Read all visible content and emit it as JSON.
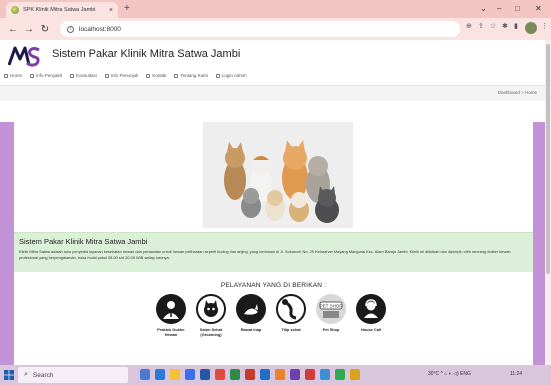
{
  "browser": {
    "tab_title": "SPK Klinik Mitra Satwa Jambi",
    "tab_close": "×",
    "new_tab": "+",
    "url": "localhost:8000",
    "minimize": "⌄",
    "min": "–",
    "max": "□",
    "close": "✕"
  },
  "site": {
    "title": "Sistem Pakar Klinik Mitra Satwa Jambi",
    "menu": [
      {
        "label": "Home"
      },
      {
        "label": "Info Penyakit"
      },
      {
        "label": "Konsultasi"
      },
      {
        "label": "Info Penunjuk"
      },
      {
        "label": "Kontak"
      },
      {
        "label": "Tentang Kami"
      },
      {
        "label": "Login Admin"
      }
    ],
    "breadcrumb": "Dashboard  >  Home"
  },
  "info": {
    "title": "Sistem Pakar Klinik Mitra Satwa Jambi",
    "text": "Klinik Mitra Satwa adalah toko penyedia layanan kesehatan hewan dan perawatan untuk hewan peliharaan seperti kucing dan anjing, yang berlokasi di Jl. Sukaruch No. 29 Kelurahan Mayang Mangurai Kec. Alam Barajo Jambi. Klinik ini didirikan dan dipimpin oleh seorang dokter hewan profesional yang berpengalaman, buka mulai pukul 08.00 s/d 20.00 WIB setiap harinya."
  },
  "services": {
    "heading": "PELAYANAN YANG DI BERIKAN :",
    "items": [
      {
        "label": "Praktek Dokter Hewan",
        "icon": "doctor-icon"
      },
      {
        "label": "Salon Sehat (Grooming)",
        "icon": "grooming-icon"
      },
      {
        "label": "Rawat Inap",
        "icon": "cat-sleeping-icon"
      },
      {
        "label": "Titip sehat",
        "icon": "cat-jumping-icon"
      },
      {
        "label": "Pet Shop",
        "icon": "pet-shop-icon"
      },
      {
        "label": "House Call",
        "icon": "house-call-icon"
      }
    ]
  },
  "taskbar": {
    "search_placeholder": "Search",
    "tray": "30°C  ^  ⌂  ◐  ◁)  ENG",
    "time": "11:24"
  },
  "colors": {
    "tab_bar": "#f3c6c4",
    "purple_band": "#c493d7",
    "info_bg": "#dcefd8",
    "taskbar": "#d9c6dc"
  }
}
